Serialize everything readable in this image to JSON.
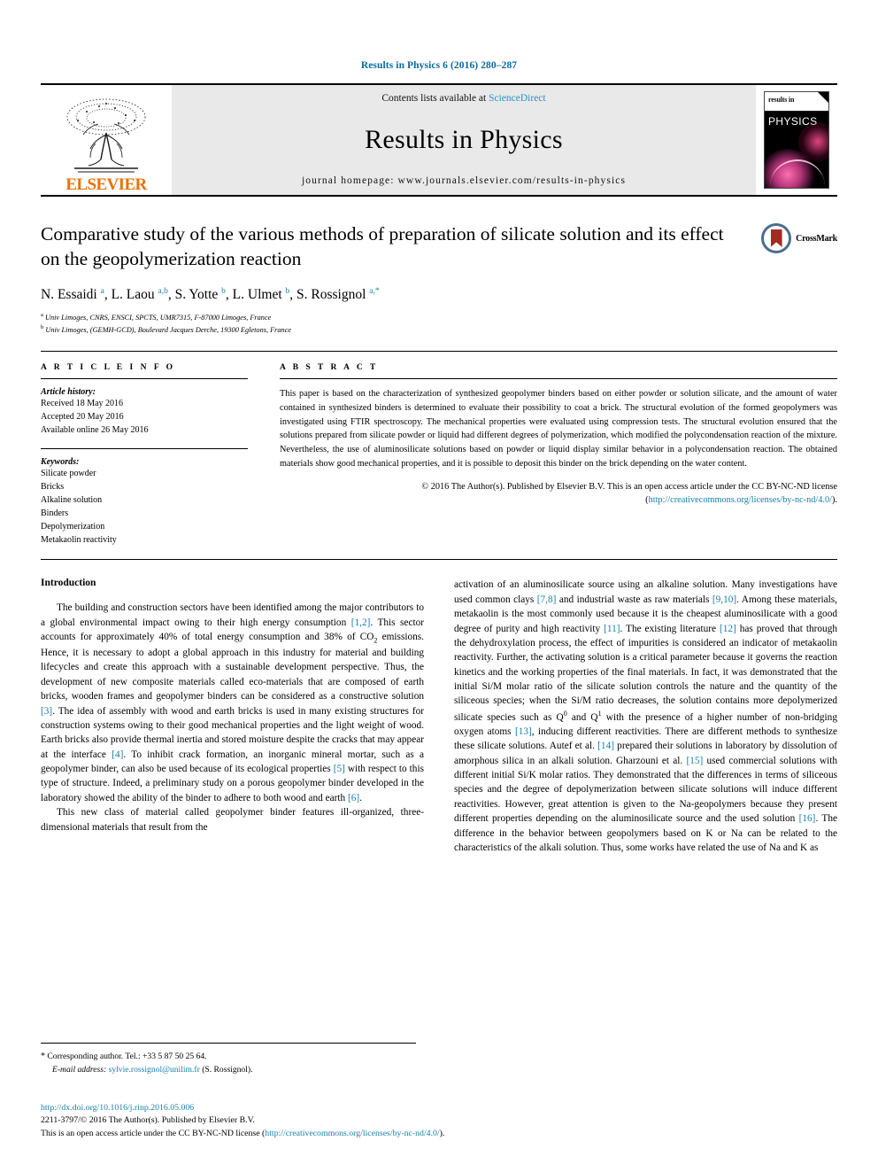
{
  "running_head": "Results in Physics 6 (2016) 280–287",
  "masthead": {
    "contents_text": "Contents lists available at",
    "sciencedirect": "ScienceDirect",
    "journal_title": "Results in Physics",
    "homepage": "journal homepage: www.journals.elsevier.com/results-in-physics",
    "publisher": "ELSEVIER",
    "cover": {
      "line1": "results in",
      "line2": "PHYSICS"
    }
  },
  "article": {
    "title": "Comparative study of the various methods of preparation of silicate solution and its effect on the geopolymerization reaction",
    "authors_html": "N. Essaidi <sup>a</sup>, L. Laou <sup>a,b</sup>, S. Yotte <sup>b</sup>, L. Ulmet <sup>b</sup>, S. Rossignol <sup>a,*</sup>",
    "affiliation_a": "Univ Limoges, CNRS, ENSCI, SPCTS, UMR7315, F-87000 Limoges, France",
    "affiliation_b": "Univ Limoges, (GEMH-GCD), Boulevard Jacques Derche, 19300 Egletons, France",
    "crossmark_label": "CrossMark"
  },
  "info": {
    "heading": "A R T I C L E   I N F O",
    "history_title": "Article history:",
    "history": [
      "Received 18 May 2016",
      "Accepted 20 May 2016",
      "Available online 26 May 2016"
    ],
    "keywords_title": "Keywords:",
    "keywords": [
      "Silicate powder",
      "Bricks",
      "Alkaline solution",
      "Binders",
      "Depolymerization",
      "Metakaolin reactivity"
    ]
  },
  "abstract": {
    "heading": "A B S T R A C T",
    "text": "This paper is based on the characterization of synthesized geopolymer binders based on either powder or solution silicate, and the amount of water contained in synthesized binders is determined to evaluate their possibility to coat a brick. The structural evolution of the formed geopolymers was investigated using FTIR spectroscopy. The mechanical properties were evaluated using compression tests. The structural evolution ensured that the solutions prepared from silicate powder or liquid had different degrees of polymerization, which modified the polycondensation reaction of the mixture. Nevertheless, the use of aluminosilicate solutions based on powder or liquid display similar behavior in a polycondensation reaction. The obtained materials show good mechanical properties, and it is possible to deposit this binder on the brick depending on the water content.",
    "copyright_lead": "© 2016 The Author(s). Published by Elsevier B.V. This is an open access article under the CC BY-NC-ND license (",
    "copyright_link": "http://creativecommons.org/licenses/by-nc-nd/4.0/",
    "copyright_tail": ")."
  },
  "body": {
    "intro_heading": "Introduction",
    "left_p1_a": "The building and construction sectors have been identified among the major contributors to a global environmental impact owing to their high energy consumption ",
    "left_p1_ref1": "[1,2]",
    "left_p1_b": ". This sector accounts for approximately 40% of total energy consumption and 38% of CO",
    "left_p1_sub": "2",
    "left_p1_c": " emissions. Hence, it is necessary to adopt a global approach in this industry for material and building lifecycles and create this approach with a sustainable development perspective. Thus, the development of new composite materials called eco-materials that are composed of earth bricks, wooden frames and geopolymer binders can be considered as a constructive solution ",
    "left_p1_ref2": "[3]",
    "left_p1_d": ". The idea of assembly with wood and earth bricks is used in many existing structures for construction systems owing to their good mechanical properties and the light weight of wood. Earth bricks also provide thermal inertia and stored moisture despite the cracks that may appear at the interface ",
    "left_p1_ref3": "[4]",
    "left_p1_e": ". To inhibit crack formation, an inorganic mineral mortar, such as a geopolymer binder, can also be used because of its ecological properties ",
    "left_p1_ref4": "[5]",
    "left_p1_f": " with respect to this type of structure. Indeed, a preliminary study on a porous geopolymer binder developed in the laboratory showed the ability of the binder to adhere to both wood and earth ",
    "left_p1_ref5": "[6]",
    "left_p1_g": ".",
    "left_p2": "This new class of material called geopolymer binder features ill-organized, three-dimensional materials that result from the",
    "right_p1_a": "activation of an aluminosilicate source using an alkaline solution. Many investigations have used common clays ",
    "right_ref1": "[7,8]",
    "right_p1_b": " and industrial waste as raw materials ",
    "right_ref2": "[9,10]",
    "right_p1_c": ". Among these materials, metakaolin is the most commonly used because it is the cheapest aluminosilicate with a good degree of purity and high reactivity ",
    "right_ref3": "[11]",
    "right_p1_d": ". The existing literature ",
    "right_ref4": "[12]",
    "right_p1_e": " has proved that through the dehydroxylation process, the effect of impurities is considered an indicator of metakaolin reactivity. Further, the activating solution is a critical parameter because it governs the reaction kinetics and the working properties of the final materials. In fact, it was demonstrated that the initial Si/M molar ratio of the silicate solution controls the nature and the quantity of the siliceous species; when the Si/M ratio decreases, the solution contains more depolymerized silicate species such as Q",
    "right_sup1": "0",
    "right_p1_f": " and Q",
    "right_sup2": "1",
    "right_p1_g": " with the presence of a higher number of non-bridging oxygen atoms ",
    "right_ref5": "[13]",
    "right_p1_h": ", inducing different reactivities. There are different methods to synthesize these silicate solutions. Autef et al. ",
    "right_ref6": "[14]",
    "right_p1_i": " prepared their solutions in laboratory by dissolution of amorphous silica in an alkali solution. Gharzouni et al. ",
    "right_ref7": "[15]",
    "right_p1_j": " used commercial solutions with different initial Si/K molar ratios. They demonstrated that the differences in terms of siliceous species and the degree of depolymerization between silicate solutions will induce different reactivities. However, great attention is given to the Na-geopolymers because they present different properties depending on the aluminosilicate source and the used solution ",
    "right_ref8": "[16]",
    "right_p1_k": ". The difference in the behavior between geopolymers based on K or Na can be related to the characteristics of the alkali solution. Thus, some works have related the use of Na and K as"
  },
  "footnote": {
    "star": "*",
    "corresponding": "Corresponding author. Tel.: +33 5 87 50 25 64.",
    "email_label": "E-mail address:",
    "email": "sylvie.rossignol@unilim.fr",
    "email_owner": "(S. Rossignol)."
  },
  "page_footer": {
    "doi": "http://dx.doi.org/10.1016/j.rinp.2016.05.006",
    "issn_line": "2211-3797/© 2016 The Author(s). Published by Elsevier B.V.",
    "license_lead": "This is an open access article under the CC BY-NC-ND license (",
    "license_link": "http://creativecommons.org/licenses/by-nc-nd/4.0/",
    "license_tail": ")."
  },
  "colors": {
    "link_blue": "#1a7fa8",
    "elsevier_orange": "#E8700A",
    "masthead_gray": "#e9e9e9",
    "crossmark_red": "#a32b22"
  }
}
